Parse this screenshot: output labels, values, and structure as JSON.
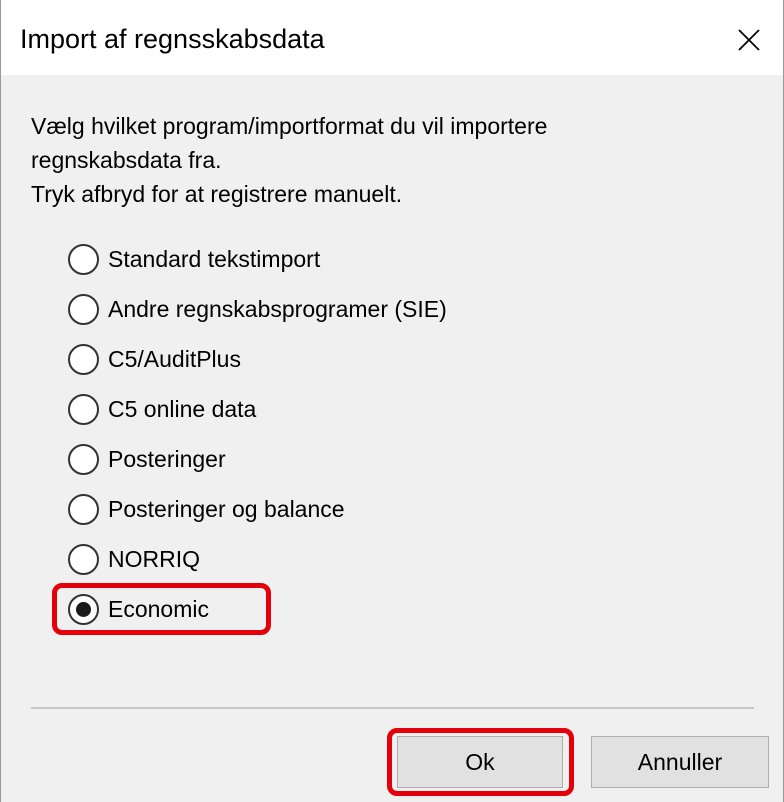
{
  "dialog": {
    "title": "Import af regnsskabsdata",
    "close_icon": "close-icon"
  },
  "description": {
    "line1": "Vælg hvilket program/importformat du vil importere",
    "line2": "regnskabsdata fra.",
    "line3": "Tryk afbryd for at registrere manuelt."
  },
  "options": [
    {
      "label": "Standard tekstimport",
      "selected": false
    },
    {
      "label": "Andre regnskabsprogramer (SIE)",
      "selected": false
    },
    {
      "label": "C5/AuditPlus",
      "selected": false
    },
    {
      "label": "C5 online data",
      "selected": false
    },
    {
      "label": "Posteringer",
      "selected": false
    },
    {
      "label": "Posteringer og balance",
      "selected": false
    },
    {
      "label": "NORRIQ",
      "selected": false
    },
    {
      "label": "Economic",
      "selected": true
    }
  ],
  "buttons": {
    "ok_label": "Ok",
    "cancel_label": "Annuller"
  },
  "colors": {
    "highlight": "#e3000b",
    "background": "#f0f0f0"
  }
}
